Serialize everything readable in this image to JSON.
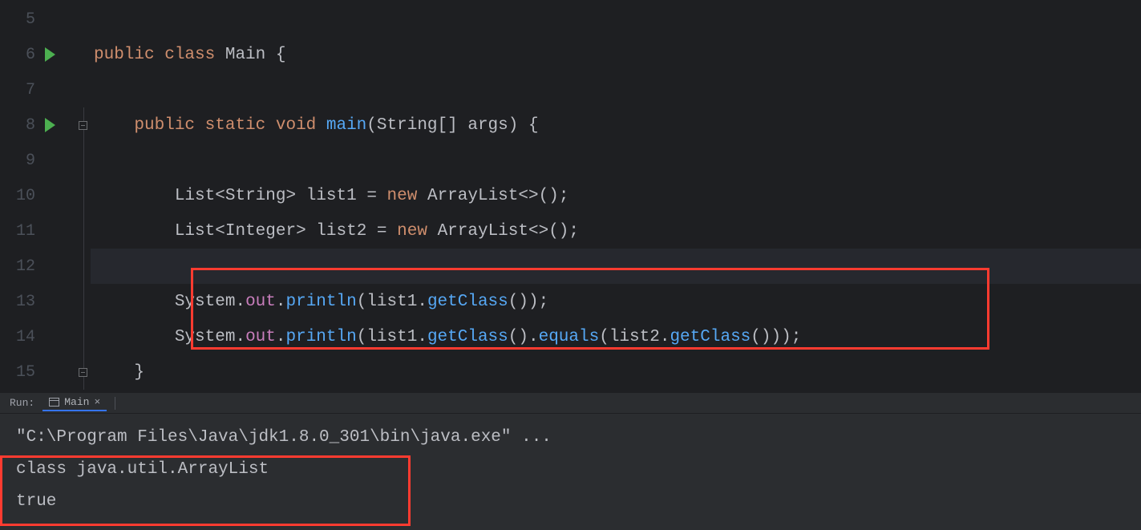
{
  "editor": {
    "lines": [
      {
        "num": "5",
        "run": false,
        "fold": "",
        "tokens": []
      },
      {
        "num": "6",
        "run": true,
        "fold": "",
        "tokens": [
          {
            "cls": "kw-public",
            "t": "public "
          },
          {
            "cls": "kw-class",
            "t": "class "
          },
          {
            "cls": "main-cls",
            "t": "Main "
          },
          {
            "cls": "brace",
            "t": "{"
          }
        ]
      },
      {
        "num": "7",
        "run": false,
        "fold": "",
        "tokens": []
      },
      {
        "num": "8",
        "run": true,
        "fold": "mark",
        "tokens": [
          {
            "cls": "",
            "t": "    "
          },
          {
            "cls": "kw-public",
            "t": "public "
          },
          {
            "cls": "kw-static",
            "t": "static "
          },
          {
            "cls": "kw-void",
            "t": "void "
          },
          {
            "cls": "method-name",
            "t": "main"
          },
          {
            "cls": "paren",
            "t": "("
          },
          {
            "cls": "type",
            "t": "String"
          },
          {
            "cls": "punct",
            "t": "[] "
          },
          {
            "cls": "var",
            "t": "args"
          },
          {
            "cls": "paren",
            "t": ") "
          },
          {
            "cls": "brace",
            "t": "{"
          }
        ]
      },
      {
        "num": "9",
        "run": false,
        "fold": "line",
        "tokens": []
      },
      {
        "num": "10",
        "run": false,
        "fold": "line",
        "tokens": [
          {
            "cls": "",
            "t": "        "
          },
          {
            "cls": "type",
            "t": "List"
          },
          {
            "cls": "angle",
            "t": "<"
          },
          {
            "cls": "type",
            "t": "String"
          },
          {
            "cls": "angle",
            "t": "> "
          },
          {
            "cls": "var",
            "t": "list1 "
          },
          {
            "cls": "punct",
            "t": "= "
          },
          {
            "cls": "kw-new",
            "t": "new "
          },
          {
            "cls": "type",
            "t": "ArrayList"
          },
          {
            "cls": "angle",
            "t": "<>"
          },
          {
            "cls": "paren",
            "t": "();"
          }
        ]
      },
      {
        "num": "11",
        "run": false,
        "fold": "line",
        "tokens": [
          {
            "cls": "",
            "t": "        "
          },
          {
            "cls": "type",
            "t": "List"
          },
          {
            "cls": "angle",
            "t": "<"
          },
          {
            "cls": "type",
            "t": "Integer"
          },
          {
            "cls": "angle",
            "t": "> "
          },
          {
            "cls": "var",
            "t": "list2 "
          },
          {
            "cls": "punct",
            "t": "= "
          },
          {
            "cls": "kw-new",
            "t": "new "
          },
          {
            "cls": "type",
            "t": "ArrayList"
          },
          {
            "cls": "angle",
            "t": "<>"
          },
          {
            "cls": "paren",
            "t": "();"
          }
        ]
      },
      {
        "num": "12",
        "run": false,
        "fold": "line",
        "current": true,
        "tokens": []
      },
      {
        "num": "13",
        "run": false,
        "fold": "line",
        "tokens": [
          {
            "cls": "",
            "t": "        "
          },
          {
            "cls": "type",
            "t": "System"
          },
          {
            "cls": "punct",
            "t": "."
          },
          {
            "cls": "field",
            "t": "out"
          },
          {
            "cls": "punct",
            "t": "."
          },
          {
            "cls": "method-name",
            "t": "println"
          },
          {
            "cls": "paren",
            "t": "("
          },
          {
            "cls": "var",
            "t": "list1"
          },
          {
            "cls": "punct",
            "t": "."
          },
          {
            "cls": "method-name",
            "t": "getClass"
          },
          {
            "cls": "paren",
            "t": "());"
          }
        ]
      },
      {
        "num": "14",
        "run": false,
        "fold": "line",
        "tokens": [
          {
            "cls": "",
            "t": "        "
          },
          {
            "cls": "type",
            "t": "System"
          },
          {
            "cls": "punct",
            "t": "."
          },
          {
            "cls": "field",
            "t": "out"
          },
          {
            "cls": "punct",
            "t": "."
          },
          {
            "cls": "method-name",
            "t": "println"
          },
          {
            "cls": "paren",
            "t": "("
          },
          {
            "cls": "var",
            "t": "list1"
          },
          {
            "cls": "punct",
            "t": "."
          },
          {
            "cls": "method-name",
            "t": "getClass"
          },
          {
            "cls": "paren",
            "t": "()"
          },
          {
            "cls": "punct",
            "t": "."
          },
          {
            "cls": "method-name",
            "t": "equals"
          },
          {
            "cls": "paren",
            "t": "("
          },
          {
            "cls": "var",
            "t": "list2"
          },
          {
            "cls": "punct",
            "t": "."
          },
          {
            "cls": "method-name",
            "t": "getClass"
          },
          {
            "cls": "paren",
            "t": "()));"
          }
        ]
      },
      {
        "num": "15",
        "run": false,
        "fold": "mark",
        "tokens": [
          {
            "cls": "",
            "t": "    "
          },
          {
            "cls": "brace",
            "t": "}"
          }
        ]
      }
    ]
  },
  "run": {
    "label": "Run:",
    "tab_name": "Main",
    "console_lines": [
      "\"C:\\Program Files\\Java\\jdk1.8.0_301\\bin\\java.exe\" ...",
      "class java.util.ArrayList",
      "true"
    ]
  }
}
